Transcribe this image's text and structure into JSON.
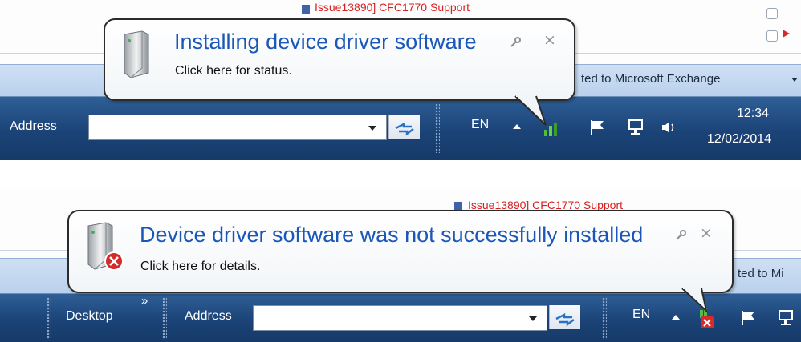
{
  "top": {
    "background": {
      "issue_text": "Issue13890] CFC1770 Support",
      "exchange_text": "ted to Microsoft Exchange"
    },
    "balloon": {
      "title": "Installing device driver software",
      "subtitle": "Click here for status.",
      "close_symbol": "×"
    },
    "taskbar": {
      "address_label": "Address",
      "address_value": "",
      "language": "EN",
      "time": "12:34",
      "date": "12/02/2014"
    }
  },
  "bottom": {
    "background": {
      "issue_text": "Issue13890] CFC1770 Support",
      "exchange_text": "ted to Mi"
    },
    "balloon": {
      "title": "Device driver software was not successfully installed",
      "subtitle": "Click here for details.",
      "close_symbol": "×"
    },
    "taskbar": {
      "desktop_label": "Desktop",
      "chevron": "»",
      "address_label": "Address",
      "address_value": "",
      "language": "EN"
    }
  },
  "colors": {
    "taskbar": "#1b4377",
    "balloon_title": "#1a57b8",
    "error_red": "#d42b2b"
  },
  "icons": [
    "usb-device-icon",
    "wrench-icon",
    "close-icon",
    "dropdown-arrow-icon",
    "go-arrows-icon",
    "show-hidden-icons-arrow",
    "network-activity-icon",
    "action-center-flag-icon",
    "network-icon",
    "volume-icon",
    "error-x-icon"
  ]
}
